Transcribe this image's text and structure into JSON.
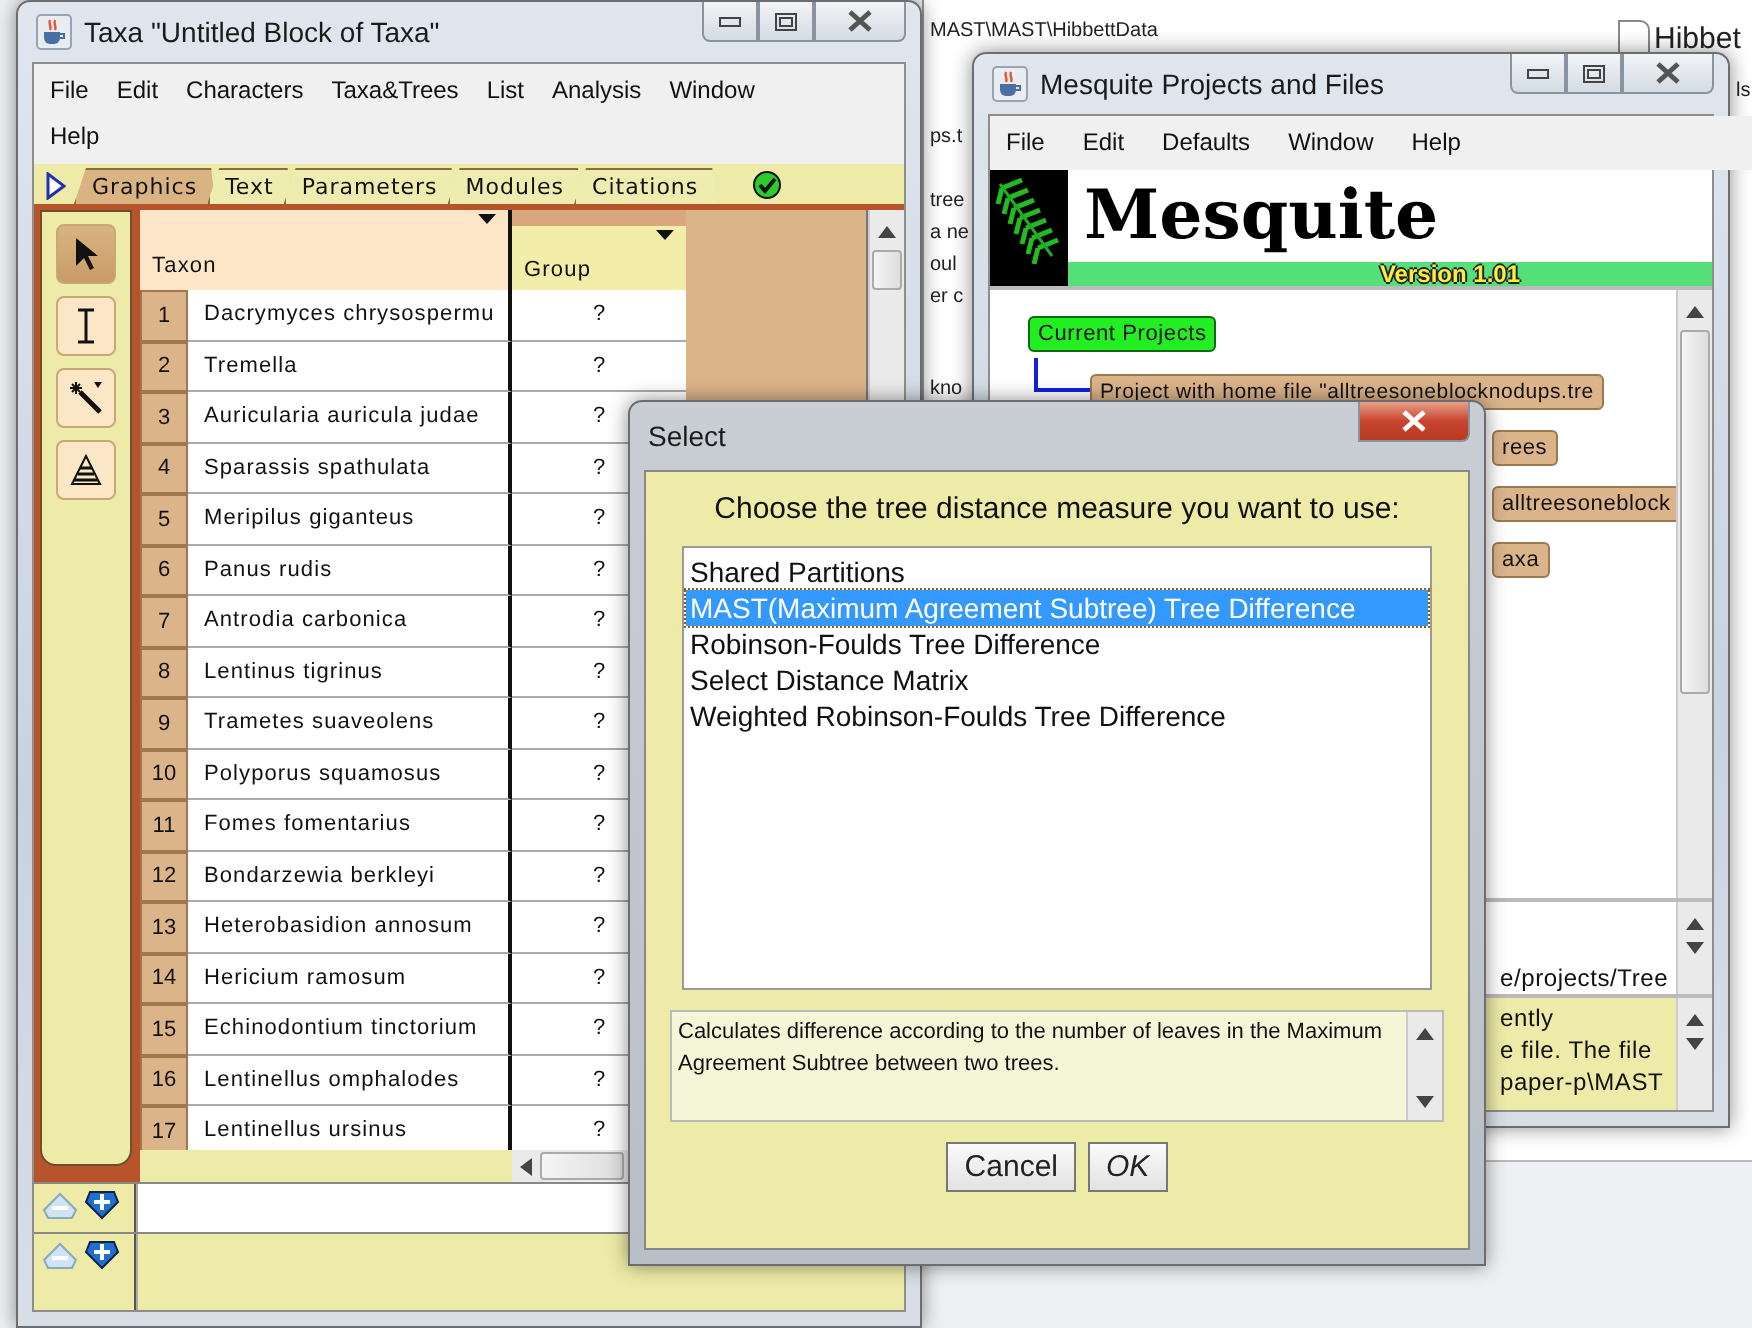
{
  "background_window": {
    "path": "MAST\\MAST\\HibbettData",
    "file_label": "Hibbet",
    "fragments": [
      "ps.t",
      "tree",
      "a ne",
      "oul",
      "er c",
      "kno",
      "ls"
    ]
  },
  "taxa_window": {
    "title": "Taxa \"Untitled Block of Taxa\"",
    "menu": [
      "File",
      "Edit",
      "Characters",
      "Taxa&Trees",
      "List",
      "Analysis",
      "Window",
      "Help"
    ],
    "tabs": [
      {
        "label": "Graphics",
        "selected": true
      },
      {
        "label": "Text",
        "selected": false
      },
      {
        "label": "Parameters",
        "selected": false
      },
      {
        "label": "Modules",
        "selected": false
      },
      {
        "label": "Citations",
        "selected": false
      }
    ],
    "tools": [
      {
        "kind": "arrow",
        "selected": true
      },
      {
        "kind": "ibeam",
        "selected": false
      },
      {
        "kind": "wand",
        "selected": false
      },
      {
        "kind": "stack",
        "selected": false
      }
    ],
    "columns": [
      "Taxon",
      "Group"
    ],
    "rows": [
      {
        "number": "1",
        "taxon": "Dacrymyces chrysospermu",
        "group": "?"
      },
      {
        "number": "2",
        "taxon": "Tremella",
        "group": "?"
      },
      {
        "number": "3",
        "taxon": "Auricularia auricula judae",
        "group": "?"
      },
      {
        "number": "4",
        "taxon": "Sparassis spathulata",
        "group": "?"
      },
      {
        "number": "5",
        "taxon": "Meripilus giganteus",
        "group": "?"
      },
      {
        "number": "6",
        "taxon": "Panus rudis",
        "group": "?"
      },
      {
        "number": "7",
        "taxon": "Antrodia carbonica",
        "group": "?"
      },
      {
        "number": "8",
        "taxon": "Lentinus tigrinus",
        "group": "?"
      },
      {
        "number": "9",
        "taxon": "Trametes suaveolens",
        "group": "?"
      },
      {
        "number": "10",
        "taxon": "Polyporus squamosus",
        "group": "?"
      },
      {
        "number": "11",
        "taxon": "Fomes fomentarius",
        "group": "?"
      },
      {
        "number": "12",
        "taxon": "Bondarzewia berkleyi",
        "group": "?"
      },
      {
        "number": "13",
        "taxon": "Heterobasidion annosum",
        "group": "?"
      },
      {
        "number": "14",
        "taxon": "Hericium ramosum",
        "group": "?"
      },
      {
        "number": "15",
        "taxon": "Echinodontium tinctorium",
        "group": "?"
      },
      {
        "number": "16",
        "taxon": "Lentinellus omphalodes",
        "group": "?"
      },
      {
        "number": "17",
        "taxon": "Lentinellus ursinus",
        "group": "?"
      }
    ]
  },
  "projects_window": {
    "title": "Mesquite Projects and Files",
    "menu": [
      "File",
      "Edit",
      "Defaults",
      "Window",
      "Help"
    ],
    "logo": {
      "name": "Mesquite",
      "version": "Version 1.01"
    },
    "nodes": [
      {
        "label": "Current Projects",
        "kind": "root"
      },
      {
        "label": "Project with home file \"alltreesoneblocknodups.tre",
        "kind": "project"
      },
      {
        "label": "rees",
        "kind": "item"
      },
      {
        "label": "alltreesoneblock",
        "kind": "item"
      },
      {
        "label": "axa",
        "kind": "item"
      }
    ],
    "info_lines": [
      "e/projects/Tree"
    ],
    "log_lines": [
      "ently",
      "e file. The file",
      "paper-p\\MAST"
    ]
  },
  "dialog": {
    "title": "Select",
    "prompt": "Choose the tree distance measure you want to use:",
    "options": [
      {
        "label": "Shared Partitions",
        "selected": false
      },
      {
        "label": "MAST(Maximum Agreement Subtree) Tree Difference",
        "selected": true
      },
      {
        "label": "Robinson-Foulds Tree Difference",
        "selected": false
      },
      {
        "label": "Select Distance Matrix",
        "selected": false
      },
      {
        "label": "Weighted Robinson-Foulds Tree Difference",
        "selected": false
      }
    ],
    "description": "Calculates difference according to the number of leaves in the Maximum Agreement Subtree between two trees.",
    "buttons": [
      {
        "label": "Cancel",
        "kind": "plain"
      },
      {
        "label": "OK",
        "kind": "default"
      }
    ]
  }
}
